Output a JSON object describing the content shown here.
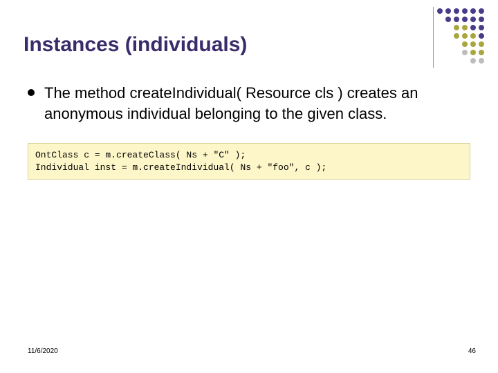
{
  "title": "Instances (individuals)",
  "bullet_text": "The method createIndividual( Resource cls ) creates an anonymous individual belonging to the given class.",
  "code": "OntClass c = m.createClass( Ns + \"C\" );\nIndividual inst = m.createIndividual( Ns + \"foo\", c );",
  "footer": {
    "date": "11/6/2020",
    "page": "46"
  },
  "deco_colors": {
    "purple": "#4a3b8a",
    "olive": "#a9a53f",
    "grey": "#bdbdbd"
  },
  "deco_grid": [
    [
      "purple",
      "purple",
      "purple",
      "purple",
      "purple",
      "purple"
    ],
    [
      "",
      "purple",
      "purple",
      "purple",
      "purple",
      "purple"
    ],
    [
      "",
      "",
      "olive",
      "olive",
      "purple",
      "purple"
    ],
    [
      "",
      "",
      "olive",
      "olive",
      "olive",
      "purple"
    ],
    [
      "",
      "",
      "",
      "olive",
      "olive",
      "olive"
    ],
    [
      "",
      "",
      "",
      "grey",
      "olive",
      "olive"
    ],
    [
      "",
      "",
      "",
      "",
      "grey",
      "grey"
    ]
  ]
}
